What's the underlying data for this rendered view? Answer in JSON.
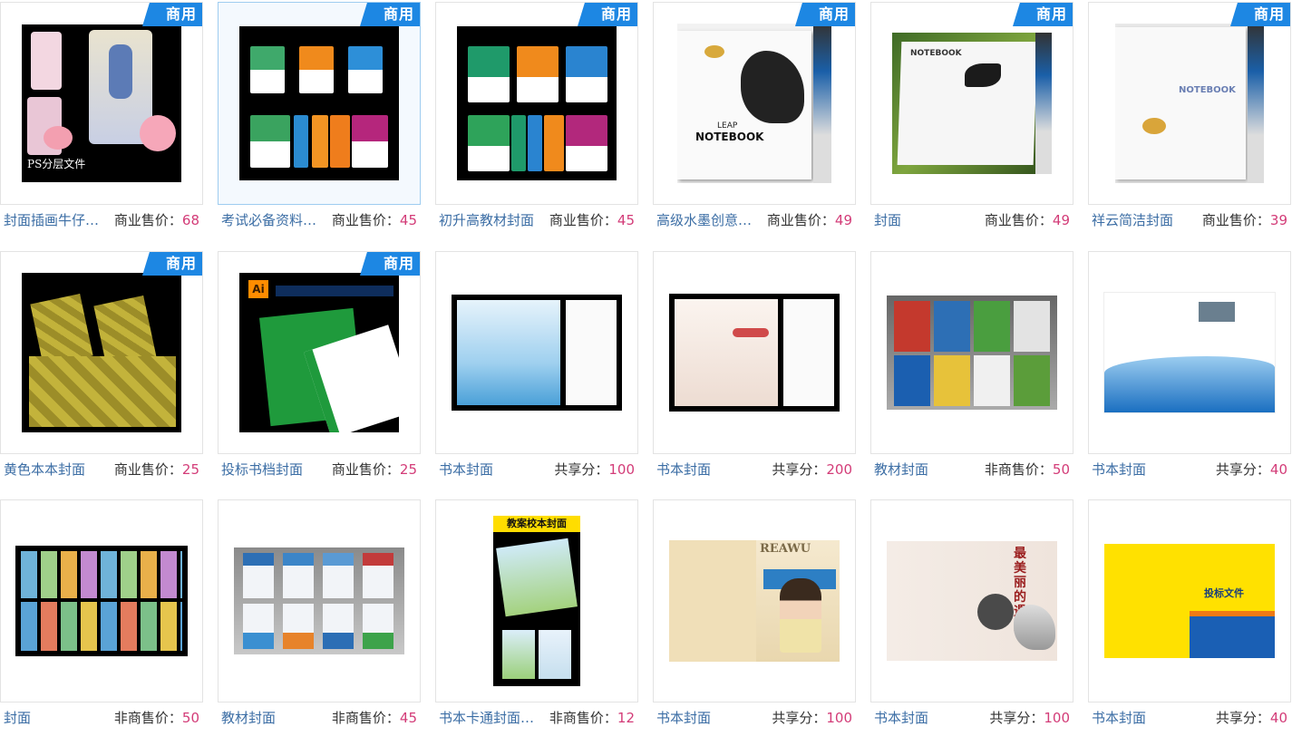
{
  "badge_label": "商用",
  "colors": {
    "accent": "#1d87e3",
    "title": "#3c6ea5",
    "price": "#d33c78"
  },
  "items": [
    {
      "title": "封面插画牛仔…",
      "price_label": "商业售价：",
      "price_value": "68",
      "commercial": true
    },
    {
      "title": "考试必备资料…",
      "price_label": "商业售价：",
      "price_value": "45",
      "commercial": true
    },
    {
      "title": "初升高教材封面",
      "price_label": "商业售价：",
      "price_value": "45",
      "commercial": true
    },
    {
      "title": "高级水墨创意…",
      "price_label": "商业售价：",
      "price_value": "49",
      "commercial": true
    },
    {
      "title": "封面",
      "price_label": "商业售价：",
      "price_value": "49",
      "commercial": true
    },
    {
      "title": "祥云简洁封面",
      "price_label": "商业售价：",
      "price_value": "39",
      "commercial": true
    },
    {
      "title": "黄色本本封面",
      "price_label": "商业售价：",
      "price_value": "25",
      "commercial": true
    },
    {
      "title": "投标书档封面",
      "price_label": "商业售价：",
      "price_value": "25",
      "commercial": true
    },
    {
      "title": "书本封面",
      "price_label": "共享分：",
      "price_value": "100",
      "commercial": false
    },
    {
      "title": "书本封面",
      "price_label": "共享分：",
      "price_value": "200",
      "commercial": false
    },
    {
      "title": "教材封面",
      "price_label": "非商售价：",
      "price_value": "50",
      "commercial": false
    },
    {
      "title": "书本封面",
      "price_label": "共享分：",
      "price_value": "40",
      "commercial": false
    },
    {
      "title": "封面",
      "price_label": "非商售价：",
      "price_value": "50",
      "commercial": false
    },
    {
      "title": "教材封面",
      "price_label": "非商售价：",
      "price_value": "45",
      "commercial": false
    },
    {
      "title": "书本卡通封面…",
      "price_label": "非商售价：",
      "price_value": "12",
      "commercial": false
    },
    {
      "title": "书本封面",
      "price_label": "共享分：",
      "price_value": "100",
      "commercial": false
    },
    {
      "title": "书本封面",
      "price_label": "共享分：",
      "price_value": "100",
      "commercial": false
    },
    {
      "title": "书本封面",
      "price_label": "共享分：",
      "price_value": "40",
      "commercial": false
    }
  ],
  "thumb_texts": {
    "t1_caption": "PS分层文件",
    "t4_leap": "LEAP",
    "t4_notebook": "NOTEBOOK",
    "t5_notebook": "NOTEBOOK",
    "t6_notebook": "NOTEBOOK",
    "t8_ai": "Ai",
    "t15_heading": "教案校本封面",
    "t16_magazine": "REAWU",
    "t17_title": "最美丽的遇见",
    "t18_title": "投标文件"
  }
}
